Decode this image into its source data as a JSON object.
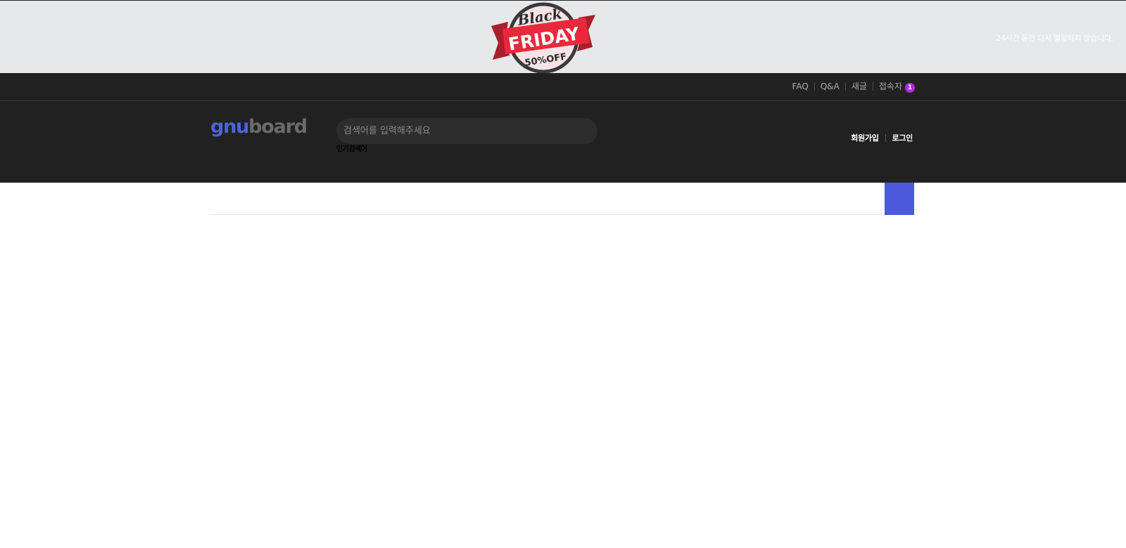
{
  "promo": {
    "badge": {
      "line1": "Black",
      "line2": "FRIDAY",
      "line3": "50%OFF"
    },
    "close_label": "24시간 동안 다시 열람하지 않습니다.",
    "colors": {
      "banner_bg": "#e7e8ea",
      "ribbon": "#e8293c",
      "ring": "#3a3a3a"
    }
  },
  "tnb": {
    "items": [
      {
        "label": "FAQ"
      },
      {
        "label": "Q&A"
      },
      {
        "label": "새글"
      },
      {
        "label": "접속자",
        "count": "1"
      }
    ]
  },
  "header": {
    "logo_part1": "gnu",
    "logo_part2": "board",
    "search_placeholder": "검색어를 입력해주세요",
    "popular_label": "인기검색어",
    "member": {
      "join_label": "회원가입",
      "login_label": "로그인"
    },
    "colors": {
      "bg": "#212121",
      "accent": "#4b63e3",
      "badge": "#b22be6"
    }
  },
  "gnb": {
    "all_menu_icon": "menu-icon",
    "colors": {
      "button": "#4b5bdb"
    }
  }
}
